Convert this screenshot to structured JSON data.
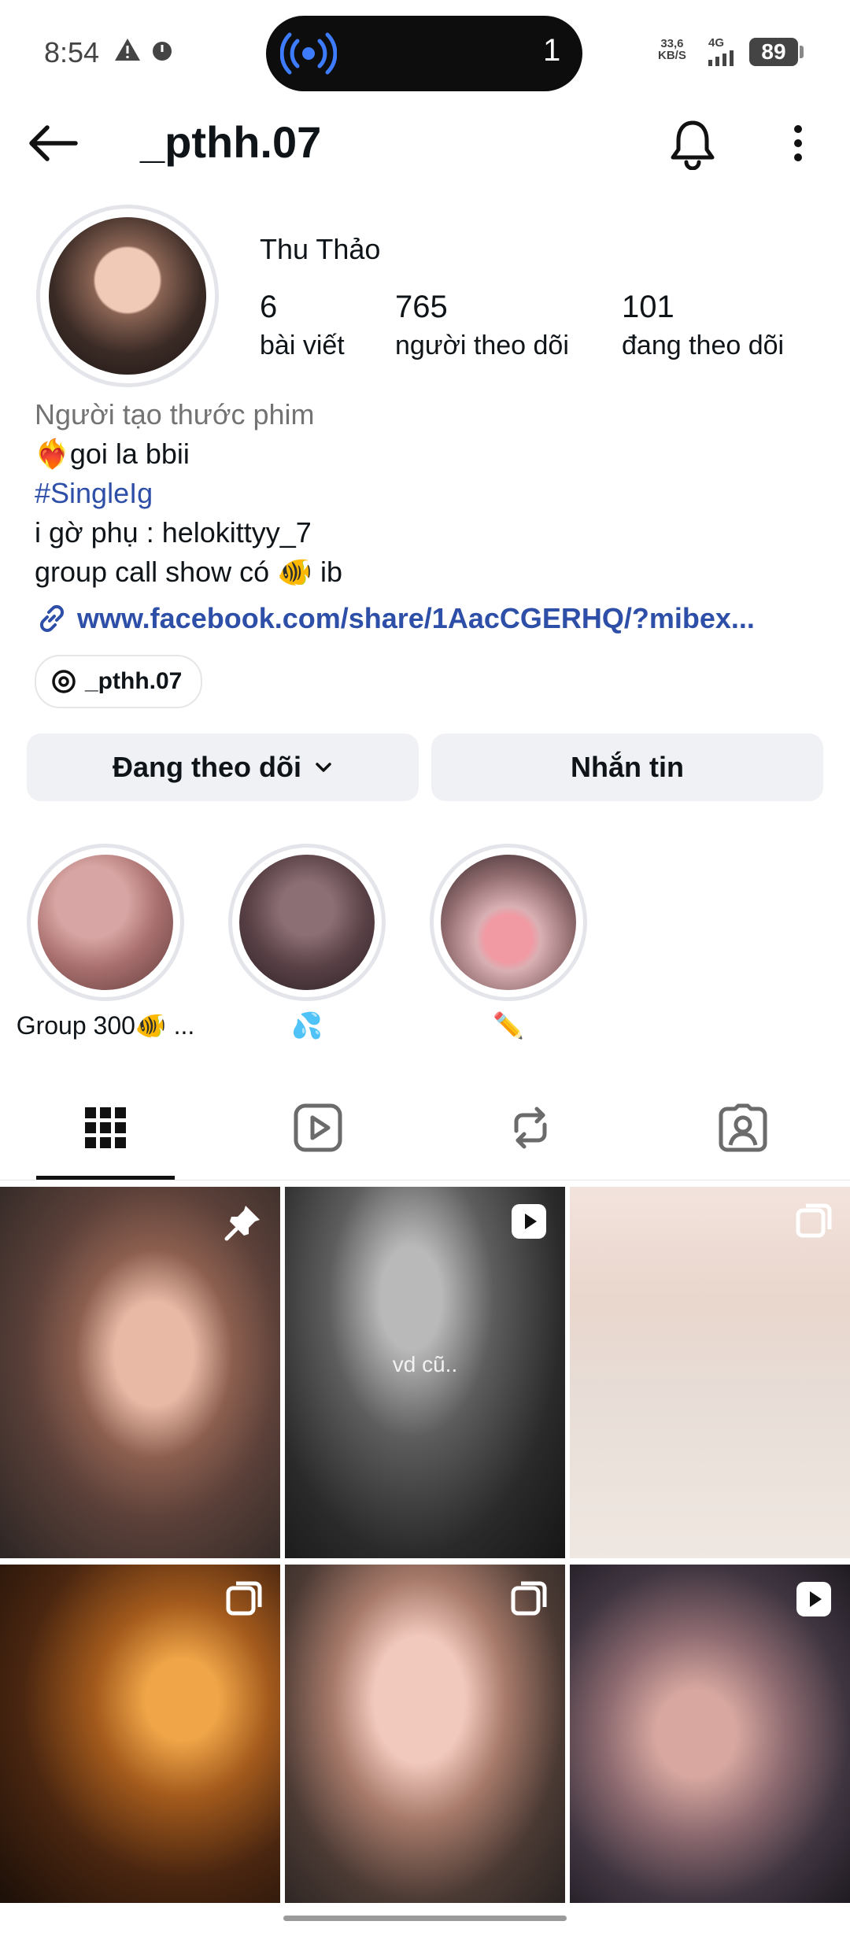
{
  "status_bar": {
    "time": "8:54",
    "pill_count": "1",
    "net_speed_value": "33,6",
    "net_speed_unit": "KB/S",
    "net_type": "4G",
    "battery": "89"
  },
  "header": {
    "username": "_pthh.07"
  },
  "profile": {
    "full_name": "Thu Thảo",
    "stats": [
      {
        "value": "6",
        "label": "bài viết"
      },
      {
        "value": "765",
        "label": "người theo dõi"
      },
      {
        "value": "101",
        "label": "đang theo dõi"
      }
    ],
    "category": "Người tạo thước phim",
    "bio": {
      "line1": "❤️‍🔥goi la bbii",
      "hashtag": "#SingleIg",
      "line3": "i gờ phụ : helokittyy_7",
      "line4": "group call show có 🐠 ib"
    },
    "link": "www.facebook.com/share/1AacCGERHQ/?mibex...",
    "threads_handle": "_pthh.07"
  },
  "actions": {
    "following_label": "Đang theo dõi",
    "message_label": "Nhắn tin"
  },
  "highlights": [
    {
      "label": "Group 300🐠 ..."
    },
    {
      "label": "💦"
    },
    {
      "label": "✏️"
    }
  ],
  "tabs": [
    {
      "icon": "grid-icon"
    },
    {
      "icon": "reels-icon"
    },
    {
      "icon": "repost-icon"
    },
    {
      "icon": "tagged-icon"
    }
  ],
  "grid_overlay_text": "vd cũ.."
}
